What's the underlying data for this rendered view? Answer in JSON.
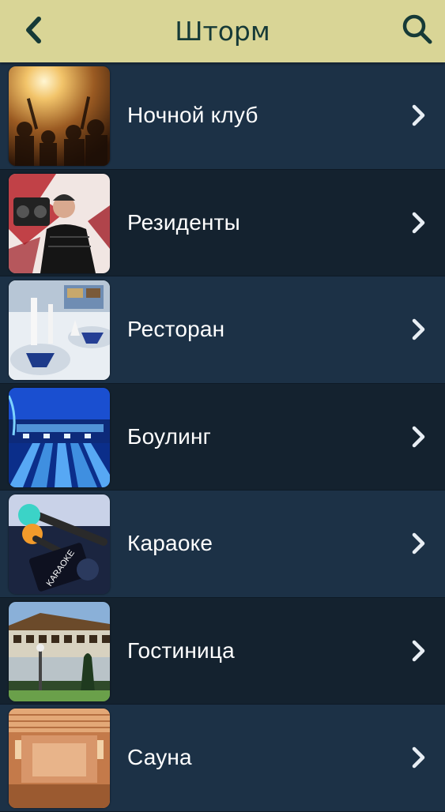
{
  "header": {
    "title": "Шторм",
    "back_icon": "chevron-left-icon",
    "search_icon": "search-icon",
    "bg_color": "#d9d596",
    "fg_color": "#163a37"
  },
  "menu": {
    "items": [
      {
        "label": "Ночной клуб",
        "thumb": "nightclub-photo"
      },
      {
        "label": "Резиденты",
        "thumb": "resident-dj-photo"
      },
      {
        "label": "Ресторан",
        "thumb": "restaurant-table-photo"
      },
      {
        "label": "Боулинг",
        "thumb": "bowling-lanes-photo"
      },
      {
        "label": "Караоке",
        "thumb": "karaoke-microphones-photo"
      },
      {
        "label": "Гостиница",
        "thumb": "hotel-building-photo"
      },
      {
        "label": "Сауна",
        "thumb": "sauna-room-photo"
      }
    ],
    "row_colors": [
      "#1c3146",
      "#14222f"
    ]
  }
}
